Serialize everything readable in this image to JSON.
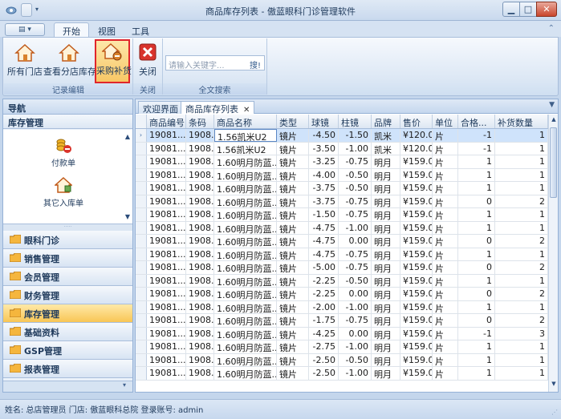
{
  "window": {
    "title": "商品库存列表 - 傲蓝眼科门诊管理软件",
    "controls": [
      "minimize",
      "maximize",
      "close"
    ]
  },
  "ribbon": {
    "tabs": [
      {
        "label": "开始",
        "active": true
      },
      {
        "label": "视图",
        "active": false
      },
      {
        "label": "工具",
        "active": false
      }
    ],
    "groups": {
      "record_edit": {
        "label": "记录编辑",
        "buttons": [
          {
            "label": "所有门店",
            "icon": "house-icon"
          },
          {
            "label": "查看分店库存",
            "icon": "house-icon"
          },
          {
            "label": "采购补货",
            "icon": "house-cart-icon",
            "selected": true
          }
        ]
      },
      "close": {
        "label": "关闭",
        "button": "关闭"
      },
      "search": {
        "label": "全文搜索",
        "placeholder": "请输入关键字...",
        "button": "搜!"
      }
    }
  },
  "nav": {
    "title": "导航",
    "section": "库存管理",
    "panel_items": [
      {
        "label": "付款单",
        "icon": "coins-icon"
      },
      {
        "label": "其它入库单",
        "icon": "house-icon"
      }
    ],
    "categories": [
      {
        "label": "眼科门诊",
        "active": false
      },
      {
        "label": "销售管理",
        "active": false
      },
      {
        "label": "会员管理",
        "active": false
      },
      {
        "label": "财务管理",
        "active": false
      },
      {
        "label": "库存管理",
        "active": true
      },
      {
        "label": "基础资料",
        "active": false
      },
      {
        "label": "GSP管理",
        "active": false
      },
      {
        "label": "报表管理",
        "active": false
      }
    ]
  },
  "doc_tabs": [
    {
      "label": "欢迎界面",
      "active": false
    },
    {
      "label": "商品库存列表",
      "active": true
    }
  ],
  "grid": {
    "columns": [
      "商品编号",
      "条码",
      "商品名称",
      "类型",
      "球镜",
      "柱镜",
      "品牌",
      "售价",
      "单位",
      "合格...",
      "补货数量"
    ],
    "rows": [
      [
        "19081...",
        "1908...",
        "1.56凯米U2",
        "镜片",
        "-4.50",
        "-1.50",
        "凯米",
        "¥120.00",
        "片",
        "-1",
        "1"
      ],
      [
        "19081...",
        "1908...",
        "1.56凯米U2",
        "镜片",
        "-3.50",
        "-1.00",
        "凯米",
        "¥120.00",
        "片",
        "-1",
        "1"
      ],
      [
        "19081...",
        "1908...",
        "1.60明月防蓝...",
        "镜片",
        "-3.25",
        "-0.75",
        "明月",
        "¥159.00",
        "片",
        "1",
        "1"
      ],
      [
        "19081...",
        "1908...",
        "1.60明月防蓝...",
        "镜片",
        "-4.00",
        "-0.50",
        "明月",
        "¥159.00",
        "片",
        "1",
        "1"
      ],
      [
        "19081...",
        "1908...",
        "1.60明月防蓝...",
        "镜片",
        "-3.75",
        "-0.50",
        "明月",
        "¥159.00",
        "片",
        "1",
        "1"
      ],
      [
        "19081...",
        "1908...",
        "1.60明月防蓝...",
        "镜片",
        "-3.75",
        "-0.75",
        "明月",
        "¥159.00",
        "片",
        "0",
        "2"
      ],
      [
        "19081...",
        "1908...",
        "1.60明月防蓝...",
        "镜片",
        "-1.50",
        "-0.75",
        "明月",
        "¥159.00",
        "片",
        "1",
        "1"
      ],
      [
        "19081...",
        "1908...",
        "1.60明月防蓝...",
        "镜片",
        "-4.75",
        "-1.00",
        "明月",
        "¥159.00",
        "片",
        "1",
        "1"
      ],
      [
        "19081...",
        "1908...",
        "1.60明月防蓝...",
        "镜片",
        "-4.75",
        "0.00",
        "明月",
        "¥159.00",
        "片",
        "0",
        "2"
      ],
      [
        "19081...",
        "1908...",
        "1.60明月防蓝...",
        "镜片",
        "-4.75",
        "-0.75",
        "明月",
        "¥159.00",
        "片",
        "1",
        "1"
      ],
      [
        "19081...",
        "1908...",
        "1.60明月防蓝...",
        "镜片",
        "-5.00",
        "-0.75",
        "明月",
        "¥159.00",
        "片",
        "0",
        "2"
      ],
      [
        "19081...",
        "1908...",
        "1.60明月防蓝...",
        "镜片",
        "-2.25",
        "-0.50",
        "明月",
        "¥159.00",
        "片",
        "1",
        "1"
      ],
      [
        "19081...",
        "1908...",
        "1.60明月防蓝...",
        "镜片",
        "-2.25",
        "0.00",
        "明月",
        "¥159.00",
        "片",
        "0",
        "2"
      ],
      [
        "19081...",
        "1908...",
        "1.60明月防蓝...",
        "镜片",
        "-2.00",
        "-1.00",
        "明月",
        "¥159.00",
        "片",
        "1",
        "1"
      ],
      [
        "19081...",
        "1908...",
        "1.60明月防蓝...",
        "镜片",
        "-1.75",
        "-0.75",
        "明月",
        "¥159.00",
        "片",
        "0",
        "2"
      ],
      [
        "19081...",
        "1908...",
        "1.60明月防蓝...",
        "镜片",
        "-4.25",
        "0.00",
        "明月",
        "¥159.00",
        "片",
        "-1",
        "3"
      ],
      [
        "19081...",
        "1908...",
        "1.60明月防蓝...",
        "镜片",
        "-2.75",
        "-1.00",
        "明月",
        "¥159.00",
        "片",
        "1",
        "1"
      ],
      [
        "19081...",
        "1908...",
        "1.60明月防蓝...",
        "镜片",
        "-2.50",
        "-0.50",
        "明月",
        "¥159.00",
        "片",
        "1",
        "1"
      ],
      [
        "19081...",
        "1908...",
        "1.60明月防蓝...",
        "镜片",
        "-2.50",
        "-1.00",
        "明月",
        "¥159.00",
        "片",
        "1",
        "1"
      ]
    ]
  },
  "status": {
    "text": "姓名: 总店管理员  门店: 傲蓝眼科总院  登录账号: admin"
  },
  "colors": {
    "accent": "#f8c655",
    "selection": "#e0262b",
    "frame": "#95b1d6"
  }
}
